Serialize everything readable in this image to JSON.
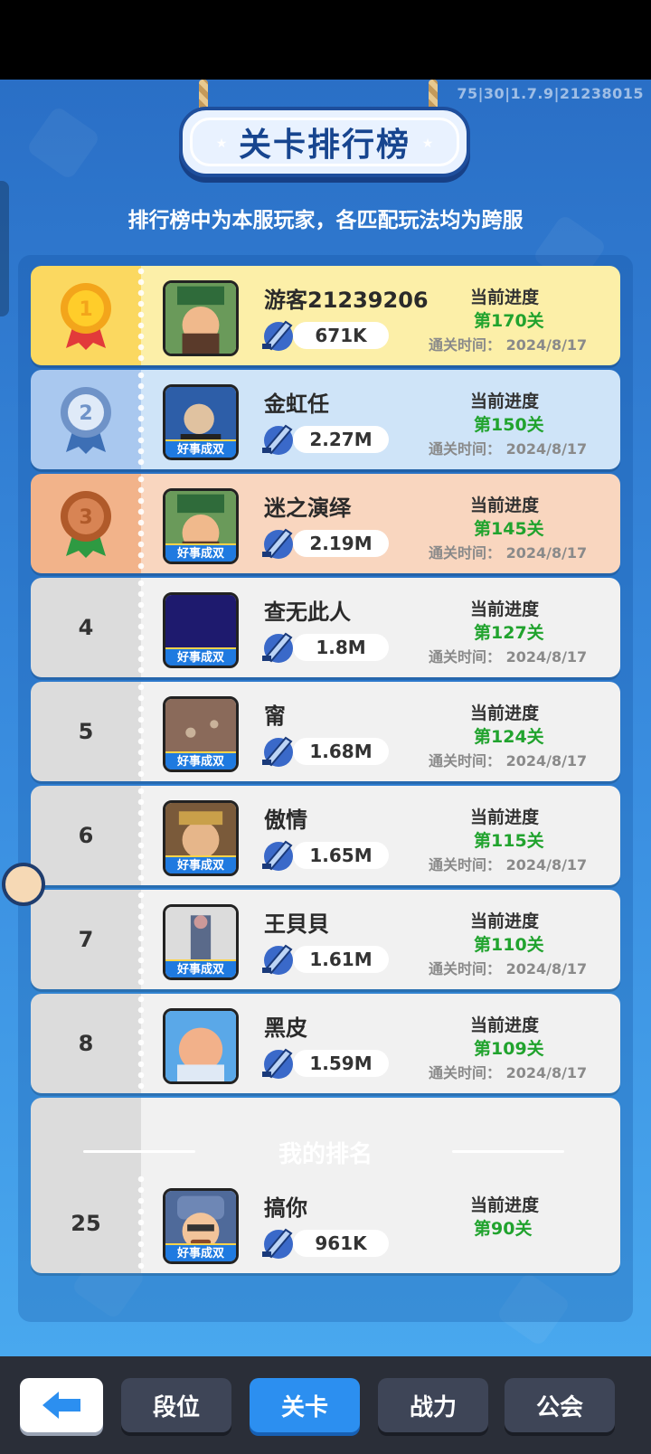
{
  "version": "75|30|1.7.9|21238015",
  "title": "关卡排行榜",
  "notice": "排行榜中为本服玩家，各匹配玩法均为跨服",
  "progress_label": "当前进度",
  "clear_time_prefix": "通关时间：",
  "tag_label": "好事成双",
  "leaderboard": [
    {
      "rank": "1",
      "name": "游客21239206",
      "power": "671K",
      "level": "第170关",
      "date": "2024/8/17",
      "style": "gold",
      "tag": false
    },
    {
      "rank": "2",
      "name": "金虹任",
      "power": "2.27M",
      "level": "第150关",
      "date": "2024/8/17",
      "style": "silver",
      "tag": true
    },
    {
      "rank": "3",
      "name": "迷之演绎",
      "power": "2.19M",
      "level": "第145关",
      "date": "2024/8/17",
      "style": "bronze",
      "tag": true
    },
    {
      "rank": "4",
      "name": "查无此人",
      "power": "1.8M",
      "level": "第127关",
      "date": "2024/8/17",
      "style": "plain",
      "tag": true
    },
    {
      "rank": "5",
      "name": "甯",
      "power": "1.68M",
      "level": "第124关",
      "date": "2024/8/17",
      "style": "plain",
      "tag": true
    },
    {
      "rank": "6",
      "name": "傲情",
      "power": "1.65M",
      "level": "第115关",
      "date": "2024/8/17",
      "style": "plain",
      "tag": true
    },
    {
      "rank": "7",
      "name": "王貝貝",
      "power": "1.61M",
      "level": "第110关",
      "date": "2024/8/17",
      "style": "plain",
      "tag": true
    },
    {
      "rank": "8",
      "name": "黑皮",
      "power": "1.59M",
      "level": "第109关",
      "date": "2024/8/17",
      "style": "plain",
      "tag": false
    }
  ],
  "my_rank": {
    "heading": "我的排名",
    "rank": "25",
    "name": "搞你",
    "power": "961K",
    "level": "第90关"
  },
  "bottom_nav": {
    "back_icon": "back-arrow-icon",
    "tabs": [
      "段位",
      "关卡",
      "战力",
      "公会"
    ],
    "active": "关卡"
  },
  "colors": {
    "accent_blue": "#2c8ff0",
    "progress_green": "#21a32e",
    "gold": "#fbd860",
    "silver": "#a9c8ef",
    "bronze": "#f2b38a"
  }
}
